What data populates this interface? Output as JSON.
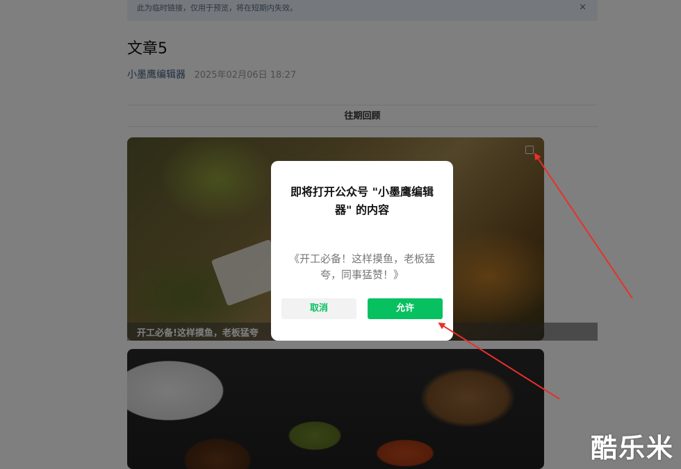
{
  "notice": {
    "text": "此为临时链接，仅用于预览，将在短期内失效。",
    "close_glyph": "×"
  },
  "article": {
    "title": "文章5",
    "author": "小墨鹰编辑器",
    "date": "2025年02月06日 18:27"
  },
  "past_review": {
    "label": "往期回顾"
  },
  "cards": [
    {
      "caption": "开工必备!这样摸鱼，老板猛夸"
    },
    {
      "caption": ""
    }
  ],
  "dialog": {
    "title": "即将打开公众号 \"小墨鹰编辑器\" 的内容",
    "description": "《开工必备！这样摸鱼，老板猛夸，同事猛赞！》",
    "cancel_label": "取消",
    "allow_label": "允许"
  },
  "colors": {
    "accent": "#07c160",
    "annotation": "#e8302a",
    "overlay": "rgba(0,0,0,0.5)"
  },
  "watermark": {
    "text": "酷乐米"
  }
}
